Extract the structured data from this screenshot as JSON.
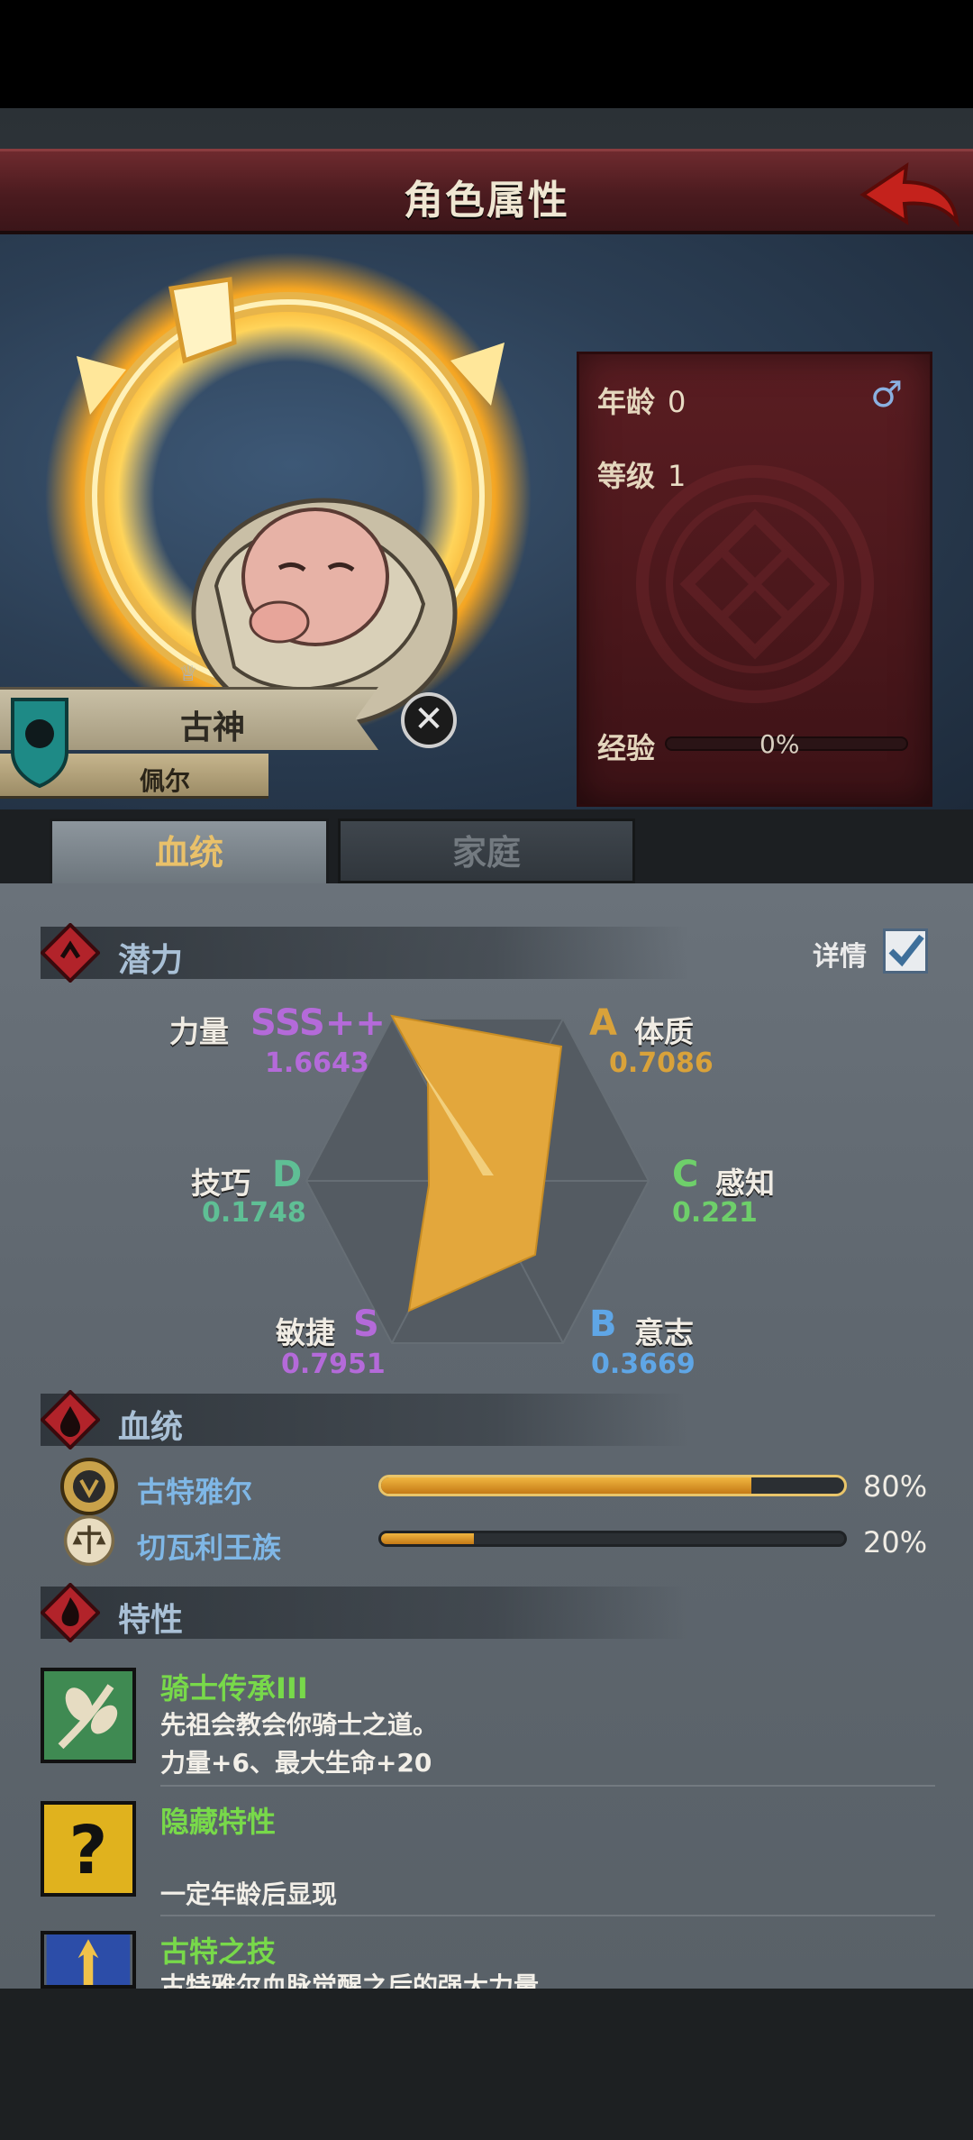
{
  "header": {
    "title": "角色属性"
  },
  "character": {
    "age_label": "年龄",
    "age_value": "0",
    "level_label": "等级",
    "level_value": "1",
    "exp_label": "经验",
    "exp_value": "0%",
    "exp_progress": 0,
    "gender_icon": "male-icon",
    "name": "古神",
    "subtitle": "佩尔"
  },
  "tabs": [
    {
      "label": "血统",
      "active": true
    },
    {
      "label": "家庭",
      "active": false
    }
  ],
  "potential": {
    "title": "潜力",
    "detail_label": "详情",
    "detail_checked": true,
    "stats": [
      {
        "name": "力量",
        "grade": "SSS++",
        "value": "1.6643",
        "color": "#b46ad9"
      },
      {
        "name": "体质",
        "grade": "A",
        "value": "0.7086",
        "color": "#d9a23a"
      },
      {
        "name": "感知",
        "grade": "C",
        "value": "0.221",
        "color": "#6ecf6a"
      },
      {
        "name": "意志",
        "grade": "B",
        "value": "0.3669",
        "color": "#5fa6e6"
      },
      {
        "name": "敏捷",
        "grade": "S",
        "value": "0.7951",
        "color": "#b46ad9"
      },
      {
        "name": "技巧",
        "grade": "D",
        "value": "0.1748",
        "color": "#5fbf95"
      }
    ]
  },
  "bloodline": {
    "title": "血统",
    "items": [
      {
        "name": "古特雅尔",
        "percent": "80%",
        "fraction": 0.8
      },
      {
        "name": "切瓦利王族",
        "percent": "20%",
        "fraction": 0.2
      }
    ]
  },
  "traits": {
    "title": "特性",
    "items": [
      {
        "name": "骑士传承III",
        "desc1": "先祖会教会你骑士之道。",
        "desc2": "力量+6、最大生命+20"
      },
      {
        "name": "隐藏特性",
        "desc1": "",
        "desc2": "一定年龄后显现"
      },
      {
        "name": "古特之技",
        "desc1": "古特雅尔血脉觉醒之后的强大力量。",
        "desc2": ""
      }
    ]
  },
  "colors": {
    "accent_gold": "#e9c16a",
    "trait_green": "#78d94a",
    "bloodline_blue": "#7fb7e6"
  }
}
